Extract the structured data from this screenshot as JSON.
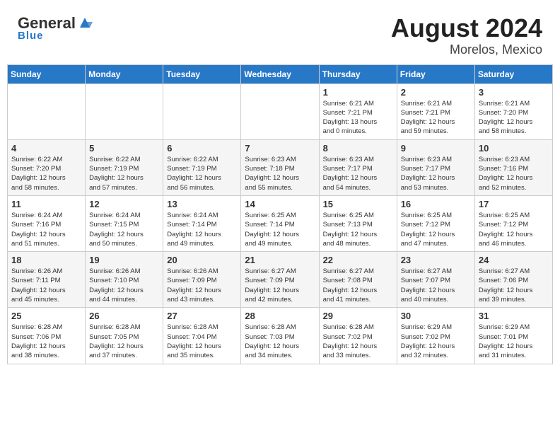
{
  "header": {
    "logo_general": "General",
    "logo_blue": "Blue",
    "month_year": "August 2024",
    "location": "Morelos, Mexico"
  },
  "days_of_week": [
    "Sunday",
    "Monday",
    "Tuesday",
    "Wednesday",
    "Thursday",
    "Friday",
    "Saturday"
  ],
  "weeks": [
    [
      {
        "day": "",
        "info": ""
      },
      {
        "day": "",
        "info": ""
      },
      {
        "day": "",
        "info": ""
      },
      {
        "day": "",
        "info": ""
      },
      {
        "day": "1",
        "info": "Sunrise: 6:21 AM\nSunset: 7:21 PM\nDaylight: 13 hours\nand 0 minutes."
      },
      {
        "day": "2",
        "info": "Sunrise: 6:21 AM\nSunset: 7:21 PM\nDaylight: 12 hours\nand 59 minutes."
      },
      {
        "day": "3",
        "info": "Sunrise: 6:21 AM\nSunset: 7:20 PM\nDaylight: 12 hours\nand 58 minutes."
      }
    ],
    [
      {
        "day": "4",
        "info": "Sunrise: 6:22 AM\nSunset: 7:20 PM\nDaylight: 12 hours\nand 58 minutes."
      },
      {
        "day": "5",
        "info": "Sunrise: 6:22 AM\nSunset: 7:19 PM\nDaylight: 12 hours\nand 57 minutes."
      },
      {
        "day": "6",
        "info": "Sunrise: 6:22 AM\nSunset: 7:19 PM\nDaylight: 12 hours\nand 56 minutes."
      },
      {
        "day": "7",
        "info": "Sunrise: 6:23 AM\nSunset: 7:18 PM\nDaylight: 12 hours\nand 55 minutes."
      },
      {
        "day": "8",
        "info": "Sunrise: 6:23 AM\nSunset: 7:17 PM\nDaylight: 12 hours\nand 54 minutes."
      },
      {
        "day": "9",
        "info": "Sunrise: 6:23 AM\nSunset: 7:17 PM\nDaylight: 12 hours\nand 53 minutes."
      },
      {
        "day": "10",
        "info": "Sunrise: 6:23 AM\nSunset: 7:16 PM\nDaylight: 12 hours\nand 52 minutes."
      }
    ],
    [
      {
        "day": "11",
        "info": "Sunrise: 6:24 AM\nSunset: 7:16 PM\nDaylight: 12 hours\nand 51 minutes."
      },
      {
        "day": "12",
        "info": "Sunrise: 6:24 AM\nSunset: 7:15 PM\nDaylight: 12 hours\nand 50 minutes."
      },
      {
        "day": "13",
        "info": "Sunrise: 6:24 AM\nSunset: 7:14 PM\nDaylight: 12 hours\nand 49 minutes."
      },
      {
        "day": "14",
        "info": "Sunrise: 6:25 AM\nSunset: 7:14 PM\nDaylight: 12 hours\nand 49 minutes."
      },
      {
        "day": "15",
        "info": "Sunrise: 6:25 AM\nSunset: 7:13 PM\nDaylight: 12 hours\nand 48 minutes."
      },
      {
        "day": "16",
        "info": "Sunrise: 6:25 AM\nSunset: 7:12 PM\nDaylight: 12 hours\nand 47 minutes."
      },
      {
        "day": "17",
        "info": "Sunrise: 6:25 AM\nSunset: 7:12 PM\nDaylight: 12 hours\nand 46 minutes."
      }
    ],
    [
      {
        "day": "18",
        "info": "Sunrise: 6:26 AM\nSunset: 7:11 PM\nDaylight: 12 hours\nand 45 minutes."
      },
      {
        "day": "19",
        "info": "Sunrise: 6:26 AM\nSunset: 7:10 PM\nDaylight: 12 hours\nand 44 minutes."
      },
      {
        "day": "20",
        "info": "Sunrise: 6:26 AM\nSunset: 7:09 PM\nDaylight: 12 hours\nand 43 minutes."
      },
      {
        "day": "21",
        "info": "Sunrise: 6:27 AM\nSunset: 7:09 PM\nDaylight: 12 hours\nand 42 minutes."
      },
      {
        "day": "22",
        "info": "Sunrise: 6:27 AM\nSunset: 7:08 PM\nDaylight: 12 hours\nand 41 minutes."
      },
      {
        "day": "23",
        "info": "Sunrise: 6:27 AM\nSunset: 7:07 PM\nDaylight: 12 hours\nand 40 minutes."
      },
      {
        "day": "24",
        "info": "Sunrise: 6:27 AM\nSunset: 7:06 PM\nDaylight: 12 hours\nand 39 minutes."
      }
    ],
    [
      {
        "day": "25",
        "info": "Sunrise: 6:28 AM\nSunset: 7:06 PM\nDaylight: 12 hours\nand 38 minutes."
      },
      {
        "day": "26",
        "info": "Sunrise: 6:28 AM\nSunset: 7:05 PM\nDaylight: 12 hours\nand 37 minutes."
      },
      {
        "day": "27",
        "info": "Sunrise: 6:28 AM\nSunset: 7:04 PM\nDaylight: 12 hours\nand 35 minutes."
      },
      {
        "day": "28",
        "info": "Sunrise: 6:28 AM\nSunset: 7:03 PM\nDaylight: 12 hours\nand 34 minutes."
      },
      {
        "day": "29",
        "info": "Sunrise: 6:28 AM\nSunset: 7:02 PM\nDaylight: 12 hours\nand 33 minutes."
      },
      {
        "day": "30",
        "info": "Sunrise: 6:29 AM\nSunset: 7:02 PM\nDaylight: 12 hours\nand 32 minutes."
      },
      {
        "day": "31",
        "info": "Sunrise: 6:29 AM\nSunset: 7:01 PM\nDaylight: 12 hours\nand 31 minutes."
      }
    ]
  ]
}
